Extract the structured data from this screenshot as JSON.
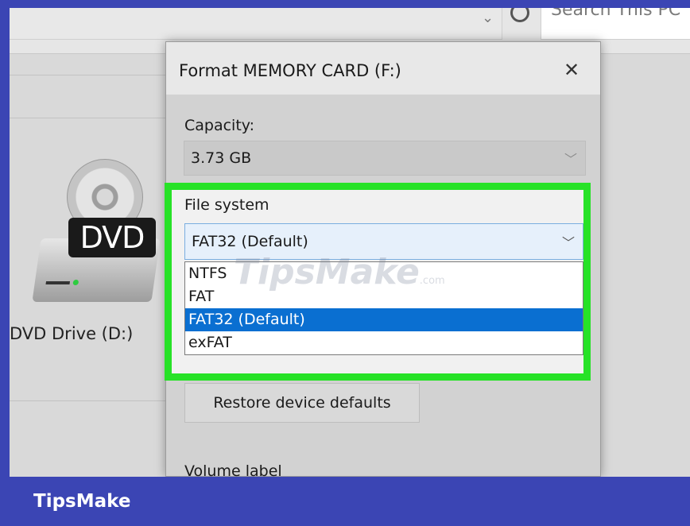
{
  "explorer": {
    "search_placeholder": "Search This PC",
    "drive": {
      "badge": "DVD",
      "label": "DVD Drive (D:)"
    }
  },
  "dialog": {
    "title": "Format MEMORY CARD (F:)",
    "close_symbol": "✕",
    "capacity": {
      "label": "Capacity:",
      "value": "3.73 GB"
    },
    "file_system": {
      "label": "File system",
      "selected": "FAT32 (Default)",
      "options": [
        "NTFS",
        "FAT",
        "FAT32 (Default)",
        "exFAT"
      ],
      "highlighted_index": 2
    },
    "restore_button": "Restore device defaults",
    "volume_label": "Volume label"
  },
  "watermark": {
    "text": "TipsMake",
    "suffix": ".com"
  },
  "footer": {
    "brand": "TipsMake"
  },
  "colors": {
    "highlight_frame": "#27e227",
    "selection": "#0a6fd1",
    "footer_bar": "#3b45b4"
  },
  "icons": [
    "chevron-down-icon",
    "refresh-icon",
    "close-icon",
    "dvd-drive-icon"
  ]
}
